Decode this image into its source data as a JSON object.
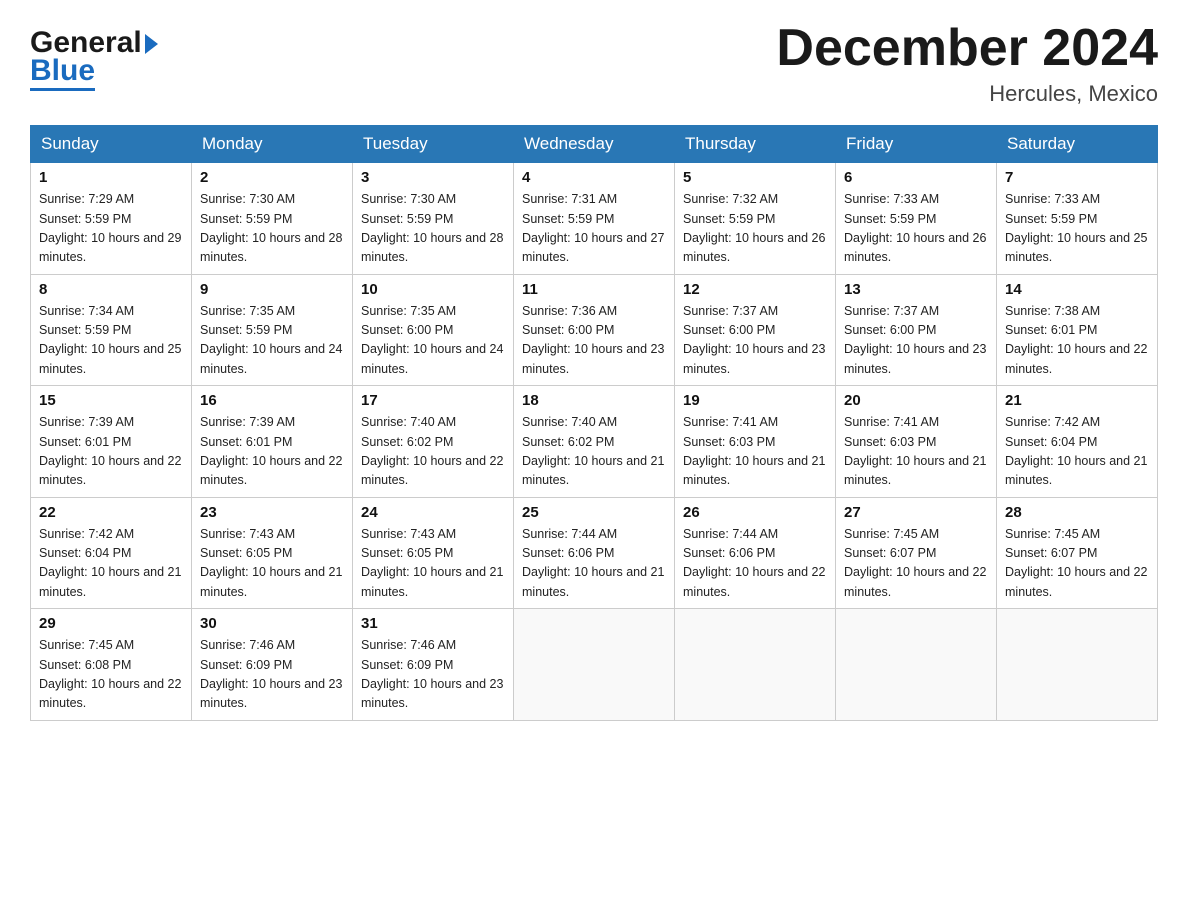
{
  "header": {
    "logo_general": "General",
    "logo_blue": "Blue",
    "month_title": "December 2024",
    "location": "Hercules, Mexico"
  },
  "days_of_week": [
    "Sunday",
    "Monday",
    "Tuesday",
    "Wednesday",
    "Thursday",
    "Friday",
    "Saturday"
  ],
  "weeks": [
    [
      {
        "num": "1",
        "sunrise": "7:29 AM",
        "sunset": "5:59 PM",
        "daylight": "10 hours and 29 minutes."
      },
      {
        "num": "2",
        "sunrise": "7:30 AM",
        "sunset": "5:59 PM",
        "daylight": "10 hours and 28 minutes."
      },
      {
        "num": "3",
        "sunrise": "7:30 AM",
        "sunset": "5:59 PM",
        "daylight": "10 hours and 28 minutes."
      },
      {
        "num": "4",
        "sunrise": "7:31 AM",
        "sunset": "5:59 PM",
        "daylight": "10 hours and 27 minutes."
      },
      {
        "num": "5",
        "sunrise": "7:32 AM",
        "sunset": "5:59 PM",
        "daylight": "10 hours and 26 minutes."
      },
      {
        "num": "6",
        "sunrise": "7:33 AM",
        "sunset": "5:59 PM",
        "daylight": "10 hours and 26 minutes."
      },
      {
        "num": "7",
        "sunrise": "7:33 AM",
        "sunset": "5:59 PM",
        "daylight": "10 hours and 25 minutes."
      }
    ],
    [
      {
        "num": "8",
        "sunrise": "7:34 AM",
        "sunset": "5:59 PM",
        "daylight": "10 hours and 25 minutes."
      },
      {
        "num": "9",
        "sunrise": "7:35 AM",
        "sunset": "5:59 PM",
        "daylight": "10 hours and 24 minutes."
      },
      {
        "num": "10",
        "sunrise": "7:35 AM",
        "sunset": "6:00 PM",
        "daylight": "10 hours and 24 minutes."
      },
      {
        "num": "11",
        "sunrise": "7:36 AM",
        "sunset": "6:00 PM",
        "daylight": "10 hours and 23 minutes."
      },
      {
        "num": "12",
        "sunrise": "7:37 AM",
        "sunset": "6:00 PM",
        "daylight": "10 hours and 23 minutes."
      },
      {
        "num": "13",
        "sunrise": "7:37 AM",
        "sunset": "6:00 PM",
        "daylight": "10 hours and 23 minutes."
      },
      {
        "num": "14",
        "sunrise": "7:38 AM",
        "sunset": "6:01 PM",
        "daylight": "10 hours and 22 minutes."
      }
    ],
    [
      {
        "num": "15",
        "sunrise": "7:39 AM",
        "sunset": "6:01 PM",
        "daylight": "10 hours and 22 minutes."
      },
      {
        "num": "16",
        "sunrise": "7:39 AM",
        "sunset": "6:01 PM",
        "daylight": "10 hours and 22 minutes."
      },
      {
        "num": "17",
        "sunrise": "7:40 AM",
        "sunset": "6:02 PM",
        "daylight": "10 hours and 22 minutes."
      },
      {
        "num": "18",
        "sunrise": "7:40 AM",
        "sunset": "6:02 PM",
        "daylight": "10 hours and 21 minutes."
      },
      {
        "num": "19",
        "sunrise": "7:41 AM",
        "sunset": "6:03 PM",
        "daylight": "10 hours and 21 minutes."
      },
      {
        "num": "20",
        "sunrise": "7:41 AM",
        "sunset": "6:03 PM",
        "daylight": "10 hours and 21 minutes."
      },
      {
        "num": "21",
        "sunrise": "7:42 AM",
        "sunset": "6:04 PM",
        "daylight": "10 hours and 21 minutes."
      }
    ],
    [
      {
        "num": "22",
        "sunrise": "7:42 AM",
        "sunset": "6:04 PM",
        "daylight": "10 hours and 21 minutes."
      },
      {
        "num": "23",
        "sunrise": "7:43 AM",
        "sunset": "6:05 PM",
        "daylight": "10 hours and 21 minutes."
      },
      {
        "num": "24",
        "sunrise": "7:43 AM",
        "sunset": "6:05 PM",
        "daylight": "10 hours and 21 minutes."
      },
      {
        "num": "25",
        "sunrise": "7:44 AM",
        "sunset": "6:06 PM",
        "daylight": "10 hours and 21 minutes."
      },
      {
        "num": "26",
        "sunrise": "7:44 AM",
        "sunset": "6:06 PM",
        "daylight": "10 hours and 22 minutes."
      },
      {
        "num": "27",
        "sunrise": "7:45 AM",
        "sunset": "6:07 PM",
        "daylight": "10 hours and 22 minutes."
      },
      {
        "num": "28",
        "sunrise": "7:45 AM",
        "sunset": "6:07 PM",
        "daylight": "10 hours and 22 minutes."
      }
    ],
    [
      {
        "num": "29",
        "sunrise": "7:45 AM",
        "sunset": "6:08 PM",
        "daylight": "10 hours and 22 minutes."
      },
      {
        "num": "30",
        "sunrise": "7:46 AM",
        "sunset": "6:09 PM",
        "daylight": "10 hours and 23 minutes."
      },
      {
        "num": "31",
        "sunrise": "7:46 AM",
        "sunset": "6:09 PM",
        "daylight": "10 hours and 23 minutes."
      },
      null,
      null,
      null,
      null
    ]
  ]
}
